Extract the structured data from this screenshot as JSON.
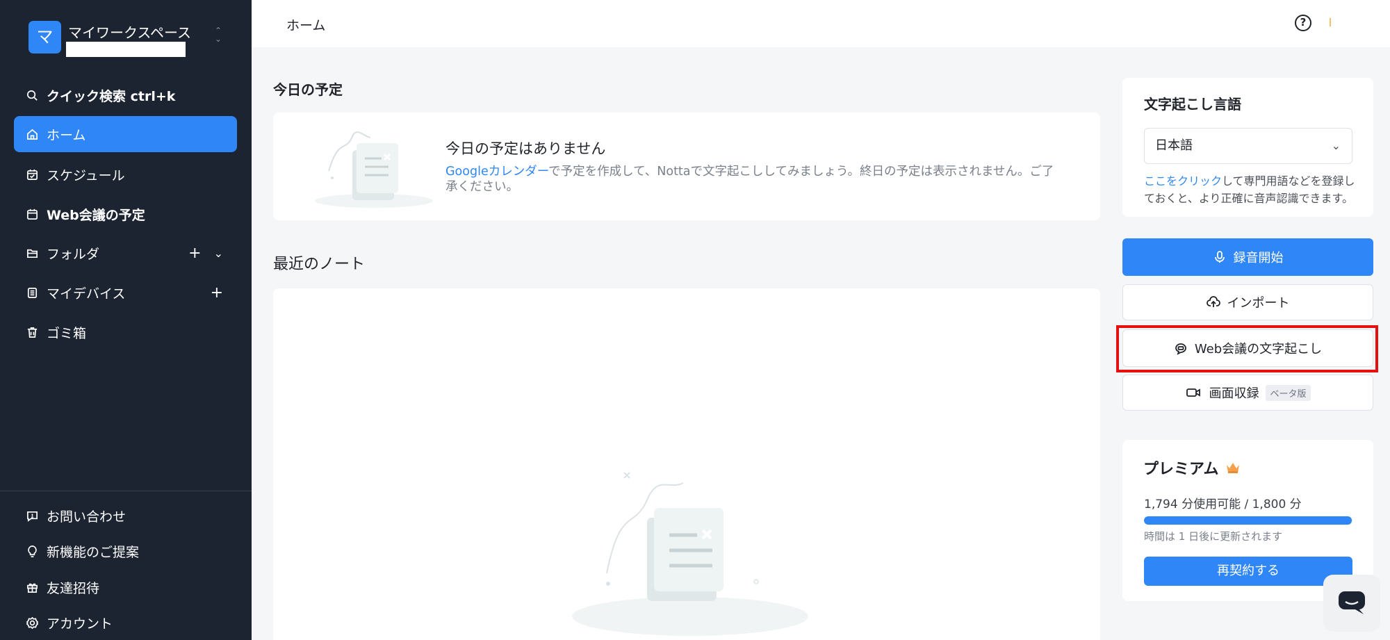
{
  "workspace": {
    "avatar_letter": "マ",
    "name": "マイワークスペース",
    "switch_icon": "chevron-up-down-icon"
  },
  "sidebar": {
    "items": [
      {
        "label": "クイック検索 ctrl+k",
        "icon": "search-icon"
      },
      {
        "label": "ホーム",
        "icon": "home-icon",
        "active": true
      },
      {
        "label": "スケジュール",
        "icon": "calendar-check-icon"
      },
      {
        "label": "Web会議の予定",
        "icon": "calendar-icon"
      },
      {
        "label": "フォルダ",
        "icon": "folder-icon"
      },
      {
        "label": "マイデバイス",
        "icon": "device-icon"
      },
      {
        "label": "ゴミ箱",
        "icon": "trash-icon"
      }
    ],
    "bottom_items": [
      {
        "label": "お問い合わせ",
        "icon": "message-alert-icon"
      },
      {
        "label": "新機能のご提案",
        "icon": "lightbulb-icon"
      },
      {
        "label": "友達招待",
        "icon": "gift-icon"
      },
      {
        "label": "アカウント",
        "icon": "settings-icon"
      }
    ]
  },
  "topbar": {
    "breadcrumb": "ホーム",
    "help_icon": "?"
  },
  "today": {
    "title": "今日の予定",
    "empty_title": "今日の予定はありません",
    "link_text": "Googleカレンダー",
    "desc_text": "で予定を作成して、Nottaで文字起こししてみましょう。終日の予定は表示されません。ご了承ください。"
  },
  "recent": {
    "title": "最近のノート"
  },
  "language": {
    "title": "文字起こし言語",
    "selected": "日本語",
    "hint_link": "ここをクリック",
    "hint_text": "して専門用語などを登録しておくと、より正確に音声認識できます。"
  },
  "actions": {
    "record": "録音開始",
    "import": "インポート",
    "web_meeting": "Web会議の文字起こし",
    "screen_record": "画面収録",
    "beta": "ベータ版"
  },
  "premium": {
    "title": "プレミアム",
    "usage": "1,794 分使用可能 / 1,800 分",
    "progress_fraction": 0.997,
    "renew_note": "時間は 1 日後に更新されます",
    "renew_button": "再契約する"
  },
  "colors": {
    "accent": "#2f86f6",
    "sidebar_bg": "#1c2331",
    "highlight": "#e51010"
  }
}
